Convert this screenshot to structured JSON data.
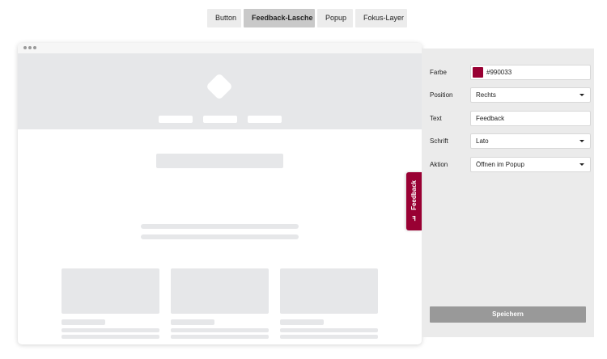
{
  "tabs": [
    {
      "label": "Button",
      "active": false
    },
    {
      "label": "Feedback-Lasche",
      "active": true
    },
    {
      "label": "Popup",
      "active": false
    },
    {
      "label": "Fokus-Layer",
      "active": false
    }
  ],
  "preview": {
    "feedback_tab": {
      "label": "Feedback",
      "icon": "feedback-f-icon",
      "color": "#990033"
    }
  },
  "settings": {
    "color": {
      "label": "Farbe",
      "value": "#990033"
    },
    "position": {
      "label": "Position",
      "value": "Rechts"
    },
    "text": {
      "label": "Text",
      "value": "Feedback"
    },
    "font": {
      "label": "Schrift",
      "value": "Lato"
    },
    "action": {
      "label": "Aktion",
      "value": "Öffnen im Popup"
    },
    "save_label": "Speichern"
  },
  "colors": {
    "accent": "#990033",
    "panel_bg": "#ebebeb",
    "placeholder": "#e6e7e9",
    "save_button": "#999999"
  }
}
